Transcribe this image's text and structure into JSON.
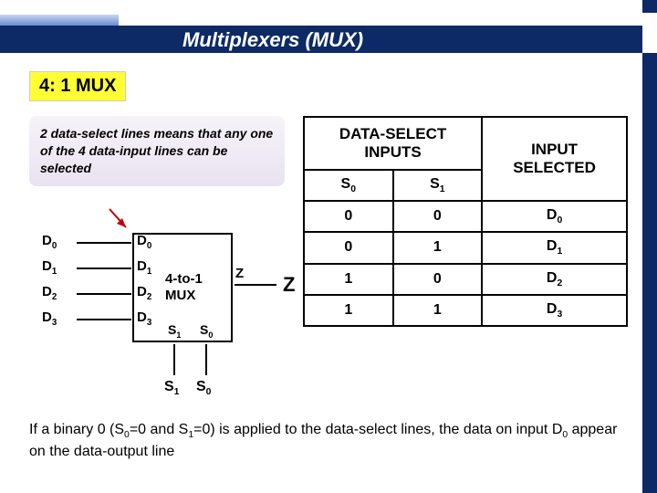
{
  "title": "Multiplexers (MUX)",
  "section_heading": "4: 1 MUX",
  "description": "2 data-select lines means that any one of the 4 data-input lines can be selected",
  "diagram": {
    "inputs": [
      "D0",
      "D1",
      "D2",
      "D3"
    ],
    "mux_label_line1": "4-to-1",
    "mux_label_line2": "MUX",
    "selects": [
      "S1",
      "S0"
    ],
    "output_pin": "Z",
    "output_ext": "Z"
  },
  "truth_table": {
    "header_ds": "DATA-SELECT INPUTS",
    "header_out": "INPUT SELECTED",
    "col_s0": "S0",
    "col_s1": "S1",
    "rows": [
      {
        "s0": "0",
        "s1": "0",
        "out": "D0"
      },
      {
        "s0": "0",
        "s1": "1",
        "out": "D1"
      },
      {
        "s0": "1",
        "s1": "0",
        "out": "D2"
      },
      {
        "s0": "1",
        "s1": "1",
        "out": "D3"
      }
    ]
  },
  "bottom_text_pre": "If a binary 0 (S",
  "bottom_text_mid1": "=0 and S",
  "bottom_text_mid2": "=0) is applied to the data-select lines, the data on input D",
  "bottom_text_post": " appear on the data-output line",
  "chart_data": {
    "type": "table",
    "title": "4:1 MUX truth table",
    "columns": [
      "S0",
      "S1",
      "INPUT SELECTED"
    ],
    "rows": [
      [
        "0",
        "0",
        "D0"
      ],
      [
        "0",
        "1",
        "D1"
      ],
      [
        "1",
        "0",
        "D2"
      ],
      [
        "1",
        "1",
        "D3"
      ]
    ]
  }
}
